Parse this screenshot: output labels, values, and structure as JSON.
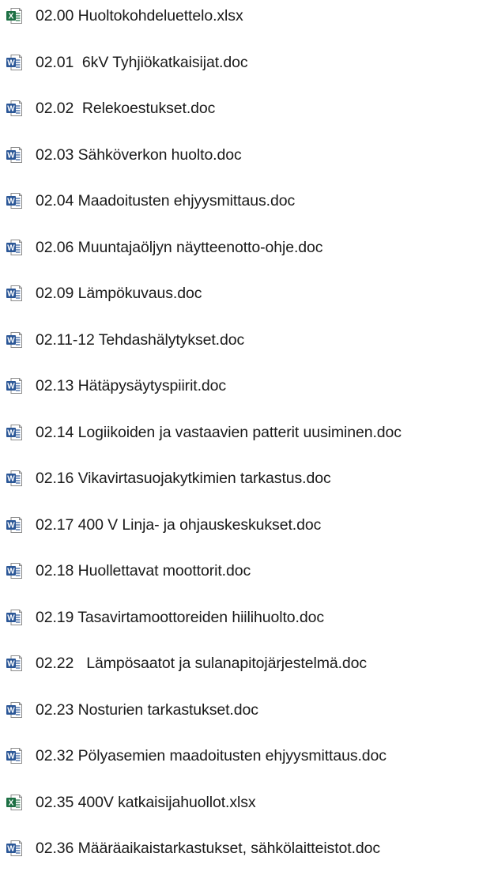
{
  "files": [
    {
      "name": "02.00 Huoltokohdeluettelo.xlsx",
      "type": "excel"
    },
    {
      "name": "02.01  6kV Tyhjiökatkaisijat.doc",
      "type": "word"
    },
    {
      "name": "02.02  Relekoestukset.doc",
      "type": "word"
    },
    {
      "name": "02.03 Sähköverkon huolto.doc",
      "type": "word"
    },
    {
      "name": "02.04 Maadoitusten ehjyysmittaus.doc",
      "type": "word"
    },
    {
      "name": "02.06 Muuntajaöljyn näytteenotto-ohje.doc",
      "type": "word"
    },
    {
      "name": "02.09 Lämpökuvaus.doc",
      "type": "word"
    },
    {
      "name": "02.11-12 Tehdashälytykset.doc",
      "type": "word"
    },
    {
      "name": "02.13 Hätäpysäytyspiirit.doc",
      "type": "word"
    },
    {
      "name": "02.14 Logiikoiden ja vastaavien patterit uusiminen.doc",
      "type": "word"
    },
    {
      "name": "02.16 Vikavirtasuojakytkimien tarkastus.doc",
      "type": "word"
    },
    {
      "name": "02.17 400 V Linja- ja ohjauskeskukset.doc",
      "type": "word"
    },
    {
      "name": "02.18 Huollettavat moottorit.doc",
      "type": "word"
    },
    {
      "name": "02.19 Tasavirtamoottoreiden hiilihuolto.doc",
      "type": "word"
    },
    {
      "name": "02.22   Lämpösaatot ja sulanapitojärjestelmä.doc",
      "type": "word"
    },
    {
      "name": "02.23 Nosturien tarkastukset.doc",
      "type": "word"
    },
    {
      "name": "02.32 Pölyasemien maadoitusten ehjyysmittaus.doc",
      "type": "word"
    },
    {
      "name": "02.35 400V katkaisijahuollot.xlsx",
      "type": "excel"
    },
    {
      "name": "02.36 Määräaikaistarkastukset, sähkölaitteistot.doc",
      "type": "word"
    }
  ],
  "icons": {
    "excel": {
      "name": "excel-file-icon",
      "color": "#1d7044"
    },
    "word": {
      "name": "word-file-icon",
      "color": "#2b5797"
    }
  }
}
